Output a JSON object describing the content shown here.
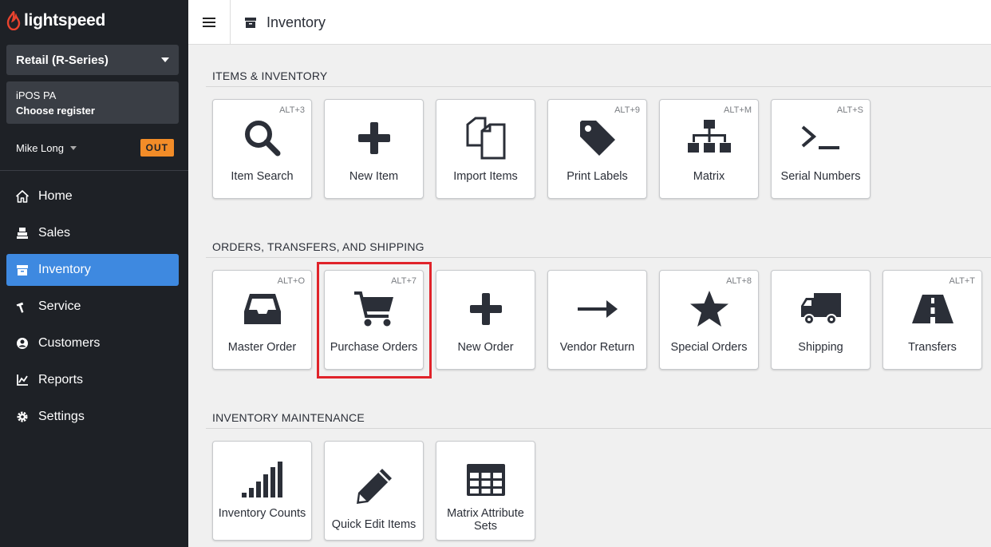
{
  "brand": {
    "logo_text": "lightspeed"
  },
  "sidebar": {
    "product": "Retail (R-Series)",
    "register": {
      "name": "iPOS PA",
      "action": "Choose register"
    },
    "user": {
      "name": "Mike Long",
      "badge": "OUT"
    },
    "nav": [
      {
        "label": "Home",
        "icon": "home-icon"
      },
      {
        "label": "Sales",
        "icon": "register-icon"
      },
      {
        "label": "Inventory",
        "icon": "archive-icon",
        "active": true
      },
      {
        "label": "Service",
        "icon": "hammer-icon"
      },
      {
        "label": "Customers",
        "icon": "user-circle-icon"
      },
      {
        "label": "Reports",
        "icon": "chart-line-icon"
      },
      {
        "label": "Settings",
        "icon": "gear-icon"
      }
    ]
  },
  "topbar": {
    "title": "Inventory"
  },
  "sections": [
    {
      "title": "ITEMS & INVENTORY",
      "tiles": [
        {
          "label": "Item Search",
          "shortcut": "ALT+3",
          "icon": "search-icon"
        },
        {
          "label": "New Item",
          "shortcut": "",
          "icon": "plus-icon"
        },
        {
          "label": "Import Items",
          "shortcut": "",
          "icon": "copy-files-icon"
        },
        {
          "label": "Print Labels",
          "shortcut": "ALT+9",
          "icon": "tag-icon"
        },
        {
          "label": "Matrix",
          "shortcut": "ALT+M",
          "icon": "sitemap-icon"
        },
        {
          "label": "Serial Numbers",
          "shortcut": "ALT+S",
          "icon": "terminal-icon"
        }
      ]
    },
    {
      "title": "ORDERS, TRANSFERS, AND SHIPPING",
      "tiles": [
        {
          "label": "Master Order",
          "shortcut": "ALT+O",
          "icon": "inbox-icon"
        },
        {
          "label": "Purchase Orders",
          "shortcut": "ALT+7",
          "icon": "cart-icon"
        },
        {
          "label": "New Order",
          "shortcut": "",
          "icon": "plus-icon"
        },
        {
          "label": "Vendor Return",
          "shortcut": "",
          "icon": "arrow-right-icon"
        },
        {
          "label": "Special Orders",
          "shortcut": "ALT+8",
          "icon": "star-icon"
        },
        {
          "label": "Shipping",
          "shortcut": "",
          "icon": "truck-icon"
        },
        {
          "label": "Transfers",
          "shortcut": "ALT+T",
          "icon": "road-icon"
        }
      ]
    },
    {
      "title": "INVENTORY MAINTENANCE",
      "tiles": [
        {
          "label": "Inventory Counts",
          "shortcut": "",
          "icon": "signal-bars-icon"
        },
        {
          "label": "Quick Edit Items",
          "shortcut": "",
          "icon": "pencil-icon"
        },
        {
          "label": "Matrix Attribute Sets",
          "shortcut": "",
          "icon": "table-grid-icon"
        }
      ]
    }
  ],
  "colors": {
    "sidebar_bg": "#1e2126",
    "active_nav": "#3e89e0",
    "badge": "#f28c28",
    "highlight": "#e0232a",
    "icon": "#2b2f38"
  }
}
